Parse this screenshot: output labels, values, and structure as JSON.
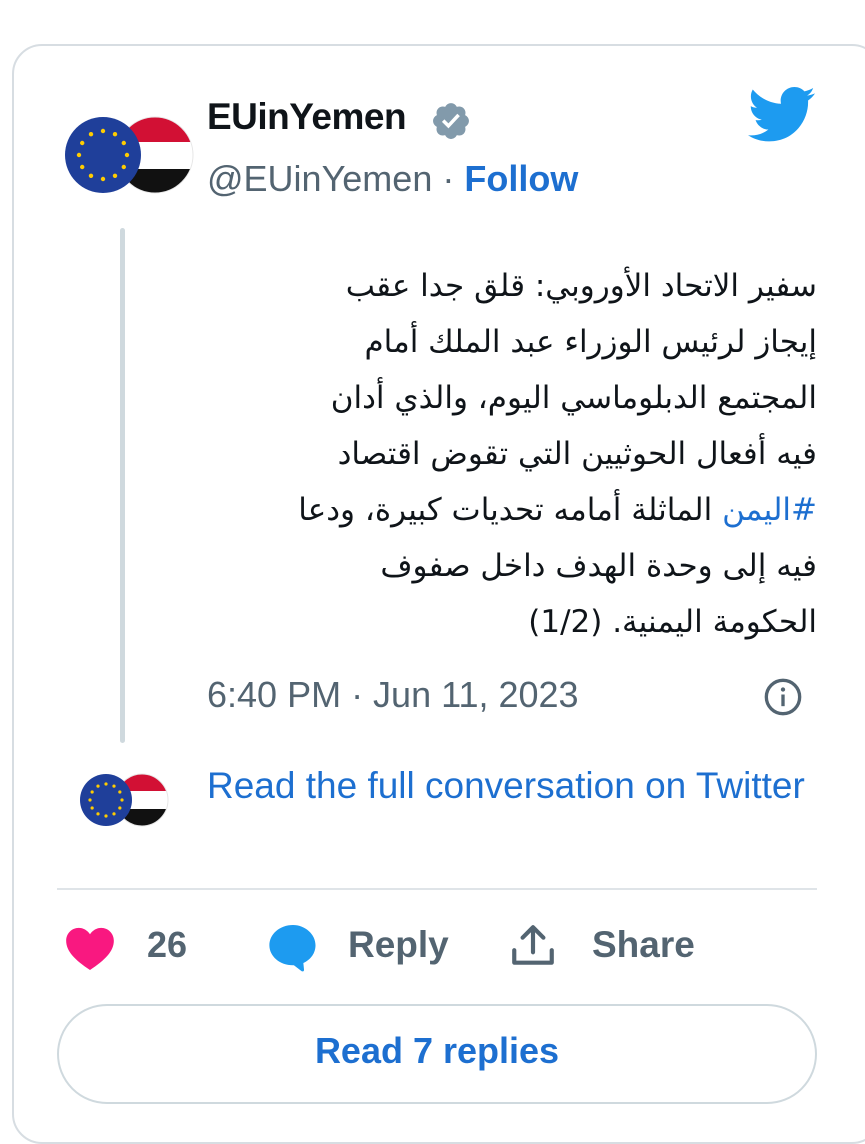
{
  "account": {
    "display_name": "EUinYemen",
    "handle": "@EUinYemen",
    "separator": " · ",
    "follow_label": "Follow",
    "avatar_icon": "eu-yemen-flag-avatar",
    "verified_icon": "verified-badge-icon"
  },
  "tweet": {
    "line1": "سفير الاتحاد الأوروبي: قلق جدا عقب",
    "line2": "إيجاز لرئيس الوزراء عبد الملك أمام",
    "line3": "المجتمع الدبلوماسي اليوم، والذي أدان",
    "line4": "فيه أفعال الحوثيين التي تقوض اقتصاد",
    "hashtag": "#اليمن",
    "line5_rest": " الماثلة أمامه تحديات كبيرة، ودعا",
    "line6": "فيه إلى وحدة الهدف داخل صفوف",
    "line7": "الحكومة اليمنية. (1/2)",
    "timestamp": "6:40 PM · Jun 11, 2023"
  },
  "conversation": {
    "read_full_label": "Read the full conversation on Twitter"
  },
  "actions": {
    "like_count": "26",
    "reply_label": "Reply",
    "share_label": "Share",
    "read_replies_label": "Read 7 replies"
  },
  "colors": {
    "link_blue": "#1d6fd0",
    "twitter_blue": "#1d9bf0",
    "heart_pink": "#f91880",
    "muted_gray": "#536471",
    "eu_blue": "#1f3f9a",
    "eu_star": "#ffcc00",
    "yemen_red": "#d21034",
    "yemen_black": "#000000"
  }
}
